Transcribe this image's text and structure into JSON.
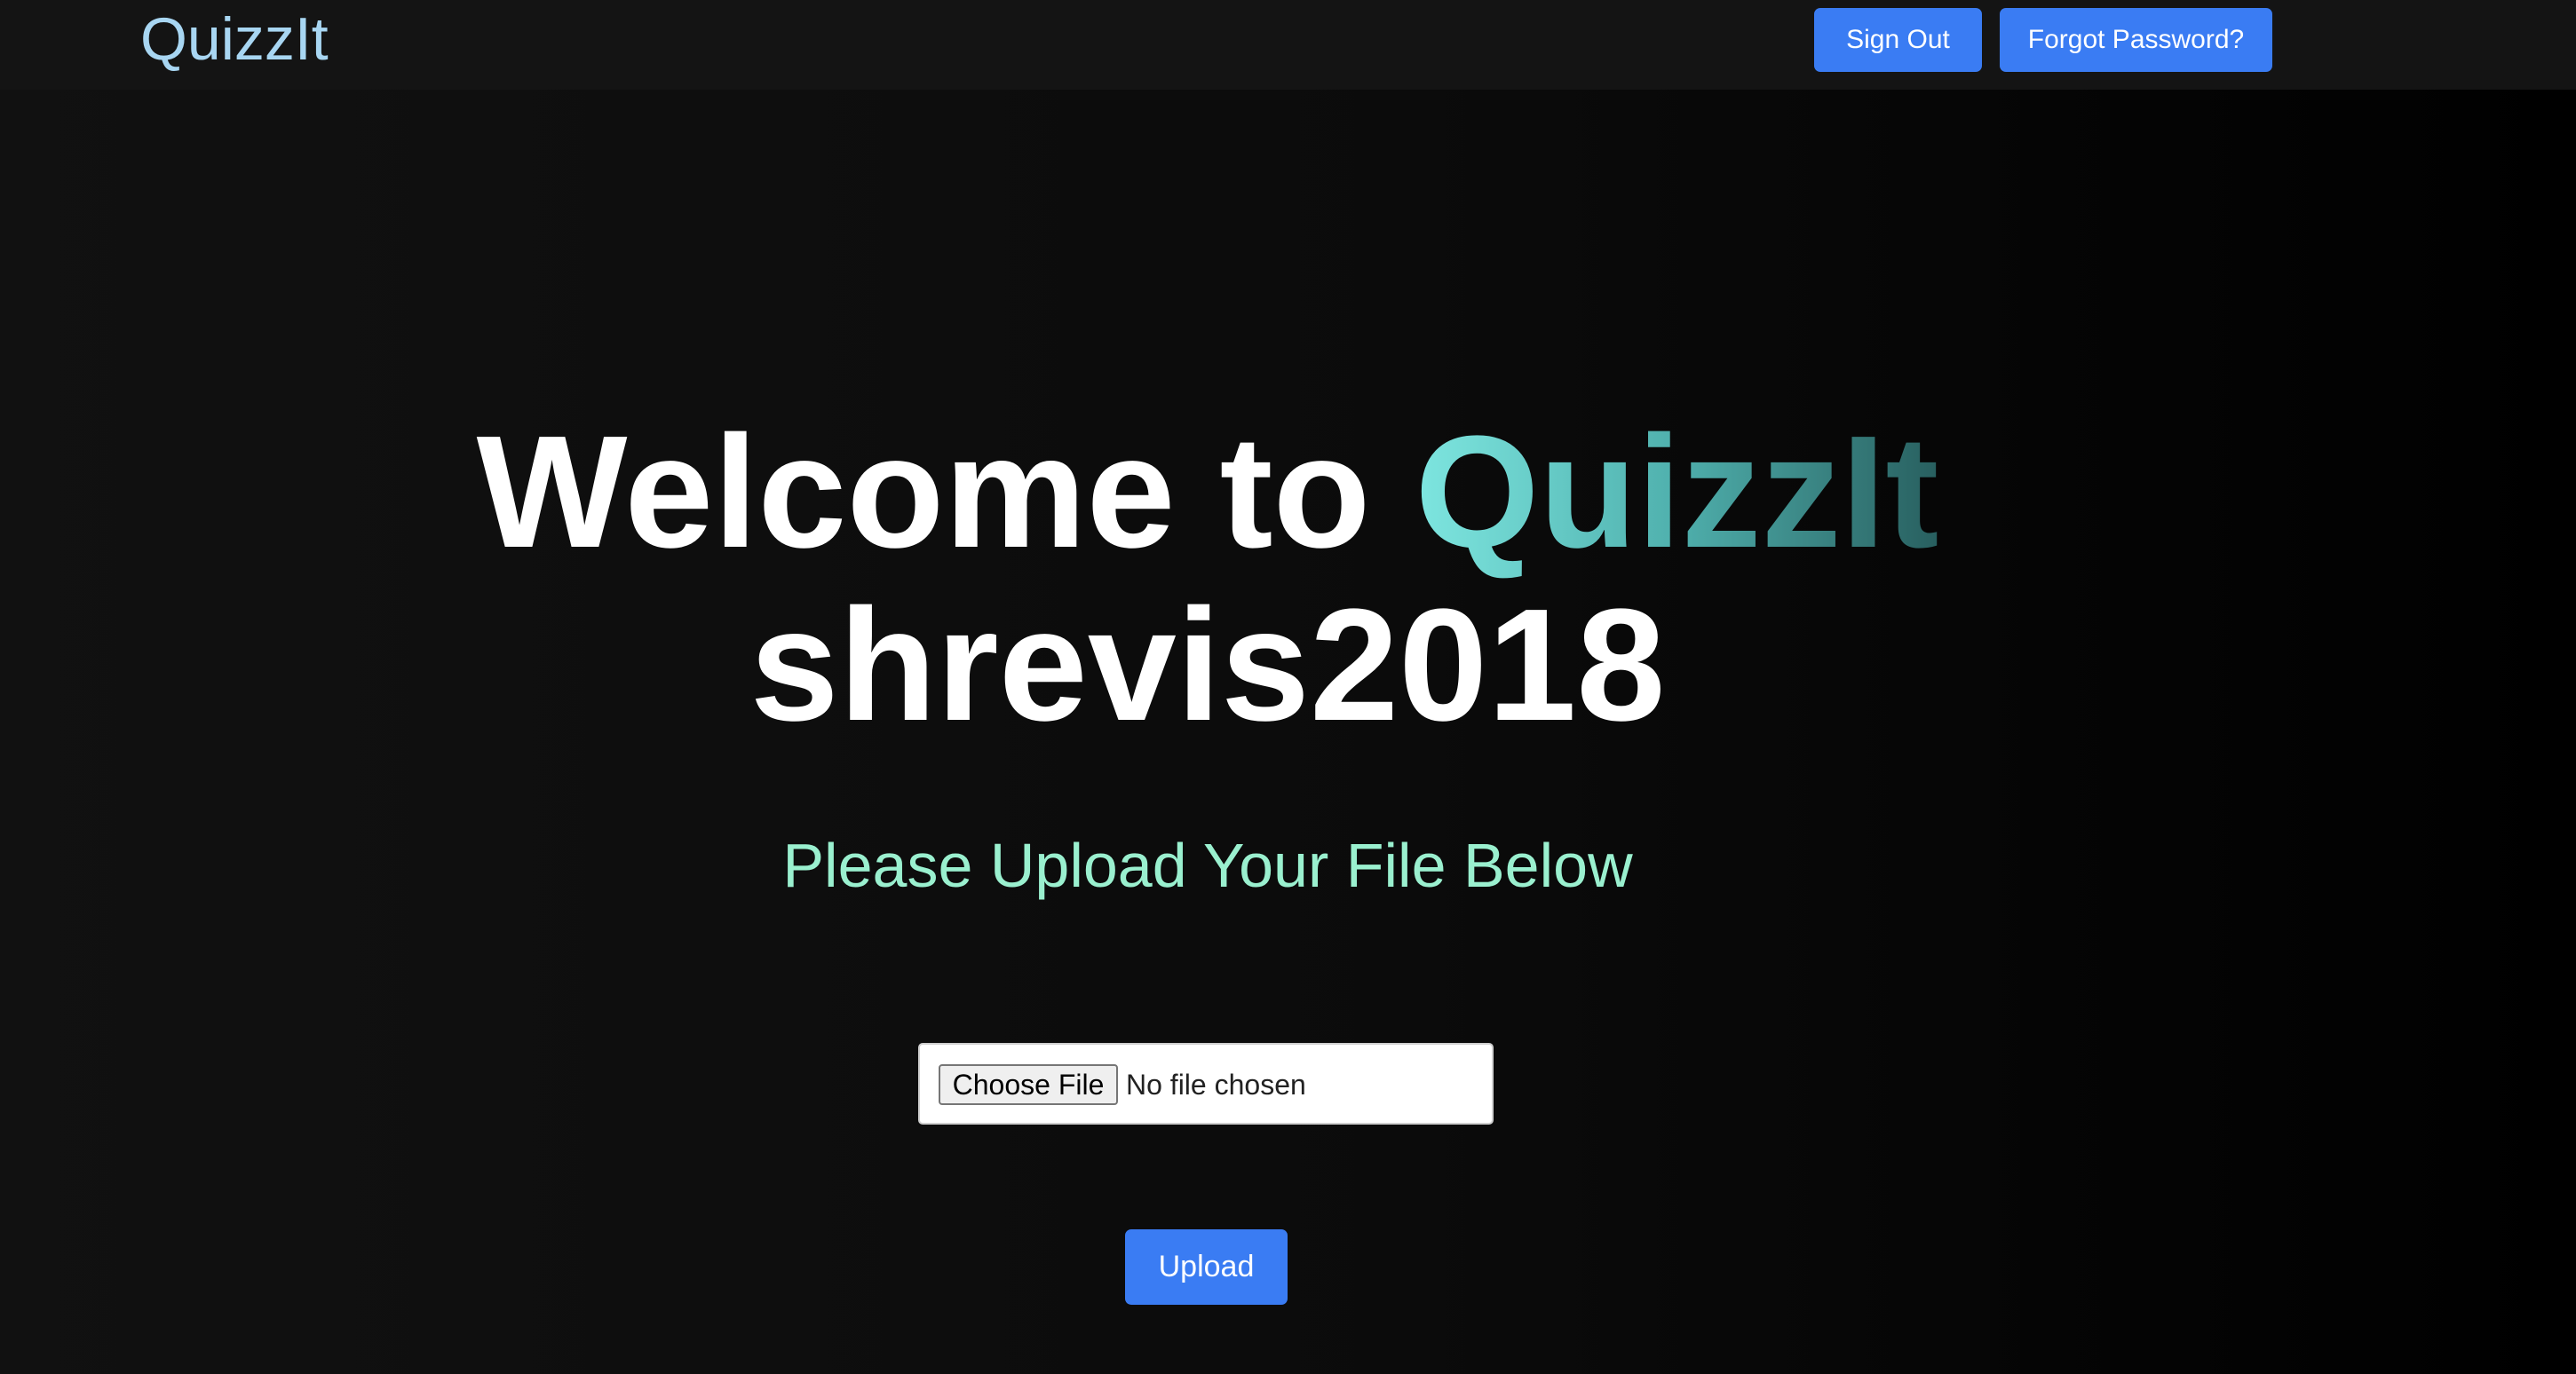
{
  "navbar": {
    "brand": "QuizzIt",
    "sign_out_label": "Sign Out",
    "forgot_password_label": "Forgot Password?"
  },
  "hero": {
    "welcome_prefix": "Welcome to ",
    "app_name": "QuizzIt",
    "username": "shrevis2018",
    "subtitle": "Please Upload Your File Below"
  },
  "upload_form": {
    "choose_file_label": "Choose File",
    "file_status": "No file chosen",
    "upload_label": "Upload"
  },
  "colors": {
    "background": "#0b0b0b",
    "navbar": "#141414",
    "brand": "#a8d6f2",
    "primary_button": "#3a7cf3",
    "subtitle": "#9af0cf",
    "accent_gradient_start": "#7ee6e0",
    "accent_gradient_end": "#285f5f"
  }
}
